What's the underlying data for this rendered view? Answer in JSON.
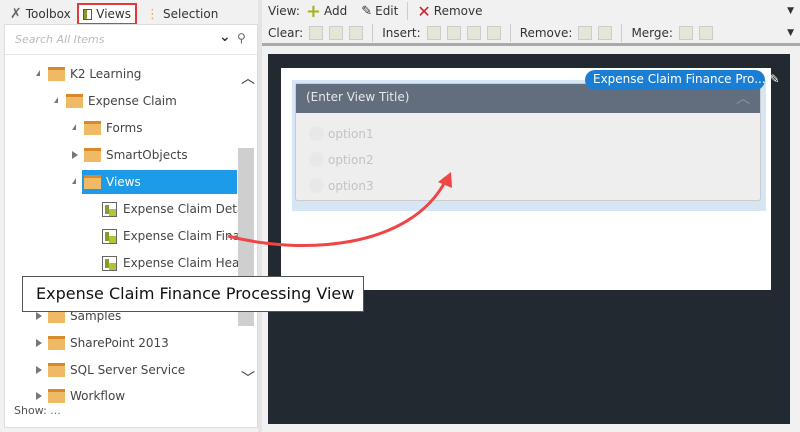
{
  "tabs": [
    {
      "label": "Toolbox",
      "icon": "wrench-icon"
    },
    {
      "label": "Views",
      "icon": "view-icon",
      "selected": true
    },
    {
      "label": "Selection",
      "icon": "hierarchy-icon"
    }
  ],
  "search": {
    "placeholder": "Search All Items"
  },
  "tree": [
    {
      "label": "K2 Learning",
      "type": "folder",
      "expanded": true
    },
    {
      "label": "Expense Claim",
      "type": "folder",
      "expanded": true
    },
    {
      "label": "Forms",
      "type": "folder",
      "expanded": true
    },
    {
      "label": "SmartObjects",
      "type": "folder",
      "expanded": false
    },
    {
      "label": "Views",
      "type": "folder",
      "expanded": true,
      "selected": true
    },
    {
      "label": "Expense Claim Deta...",
      "type": "view"
    },
    {
      "label": "Expense Claim Fina...",
      "type": "view"
    },
    {
      "label": "Expense Claim Hea...",
      "type": "view"
    },
    {
      "label": "Samples",
      "type": "folder",
      "expanded": false
    },
    {
      "label": "SharePoint 2013",
      "type": "folder",
      "expanded": false
    },
    {
      "label": "SQL Server Service",
      "type": "folder",
      "expanded": false
    },
    {
      "label": "Workflow",
      "type": "folder",
      "expanded": false
    }
  ],
  "show": {
    "label": "Show:",
    "value": "..."
  },
  "tooltip": "Expense Claim Finance Processing View",
  "toolbar": {
    "view_label": "View:",
    "add": "Add",
    "edit": "Edit",
    "remove": "Remove",
    "clear": "Clear:",
    "insert": "Insert:",
    "remove2": "Remove:",
    "merge": "Merge:"
  },
  "canvas": {
    "view_badge": "Expense Claim Finance Pro...",
    "view_title": "(Enter View Title)",
    "options": [
      "option1",
      "option2",
      "option3"
    ]
  },
  "colors": {
    "selected": "#1e9be8",
    "badge": "#1a7fd4",
    "header": "#626d7e",
    "canvas_bg": "#222931",
    "arrow": "#f04545"
  }
}
